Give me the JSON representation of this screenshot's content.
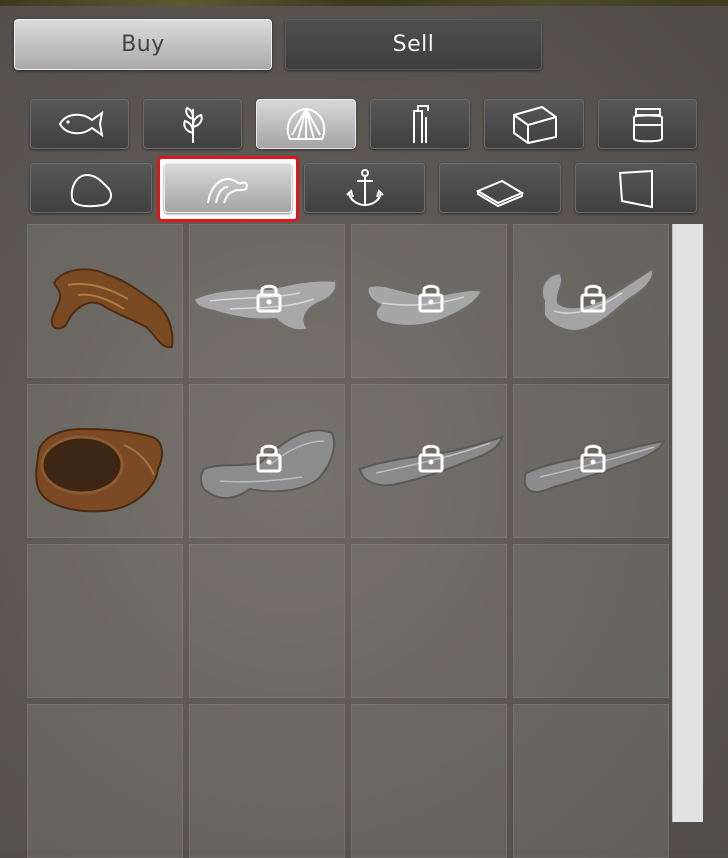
{
  "tabs": {
    "buy_label": "Buy",
    "sell_label": "Sell",
    "active": "Buy"
  },
  "categories": {
    "row1": [
      "fish-icon",
      "plant-icon",
      "shell-icon",
      "heater-icon",
      "tank-icon",
      "jar-icon"
    ],
    "row2": [
      "rock-icon",
      "driftwood-icon",
      "anchor-icon",
      "board-icon",
      "backdrop-icon"
    ],
    "selected": "driftwood-icon"
  },
  "colors": {
    "selection_outline": "#e0161e",
    "active_button": "#d0d0d0",
    "inactive_button": "#474747",
    "wood_brown": "#7a4a22",
    "wood_grey": "#a8a8a8"
  },
  "items": [
    {
      "kind": "driftwood-branch",
      "color": "brown",
      "locked": false
    },
    {
      "kind": "driftwood-long",
      "color": "grey",
      "locked": true
    },
    {
      "kind": "driftwood-twisted",
      "color": "grey",
      "locked": true
    },
    {
      "kind": "driftwood-hook",
      "color": "grey",
      "locked": true
    },
    {
      "kind": "hollow-log",
      "color": "brown",
      "locked": false
    },
    {
      "kind": "driftwood-chunk",
      "color": "grey",
      "locked": true
    },
    {
      "kind": "driftwood-stick",
      "color": "grey",
      "locked": true
    },
    {
      "kind": "driftwood-slim",
      "color": "grey",
      "locked": true
    },
    {
      "kind": "empty",
      "locked": false
    },
    {
      "kind": "empty",
      "locked": false
    },
    {
      "kind": "empty",
      "locked": false
    },
    {
      "kind": "empty",
      "locked": false
    },
    {
      "kind": "empty",
      "locked": false
    },
    {
      "kind": "empty",
      "locked": false
    },
    {
      "kind": "empty",
      "locked": false
    },
    {
      "kind": "empty",
      "locked": false
    }
  ]
}
